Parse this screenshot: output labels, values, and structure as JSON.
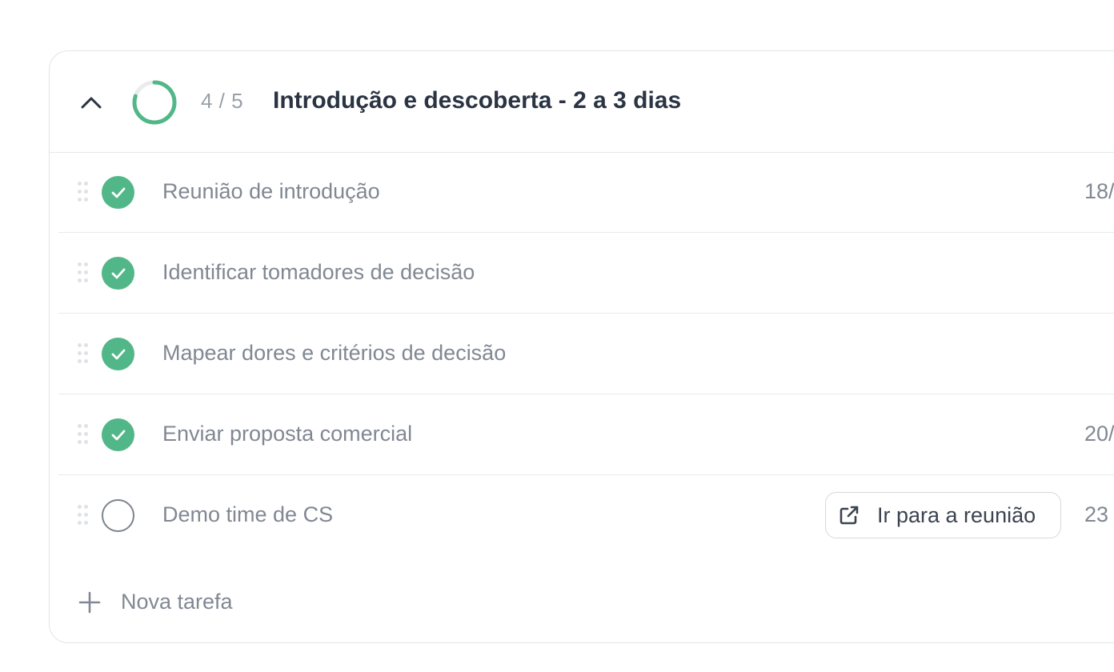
{
  "phase": {
    "title": "Introdução e descoberta - 2 a 3 dias",
    "progress_text": "4 / 5",
    "progress_fraction": 0.8,
    "collapse_icon": "chevron-up-icon",
    "progress_color": "#52b788"
  },
  "tasks": [
    {
      "label": "Reunião de introdução",
      "date": "18/",
      "done": true
    },
    {
      "label": "Identificar tomadores de decisão",
      "date": "",
      "done": true
    },
    {
      "label": "Mapear dores e critérios de decisão",
      "date": "",
      "done": true
    },
    {
      "label": "Enviar proposta comercial",
      "date": "20/",
      "done": true
    },
    {
      "label": "Demo time de CS",
      "date": "23",
      "done": false,
      "action_label": "Ir para a reunião",
      "action_icon": "external-link-icon"
    }
  ],
  "new_task": {
    "label": "Nova tarefa",
    "icon": "plus-icon"
  },
  "colors": {
    "done": "#52b788",
    "text_muted": "#818893",
    "title": "#2b3443"
  }
}
